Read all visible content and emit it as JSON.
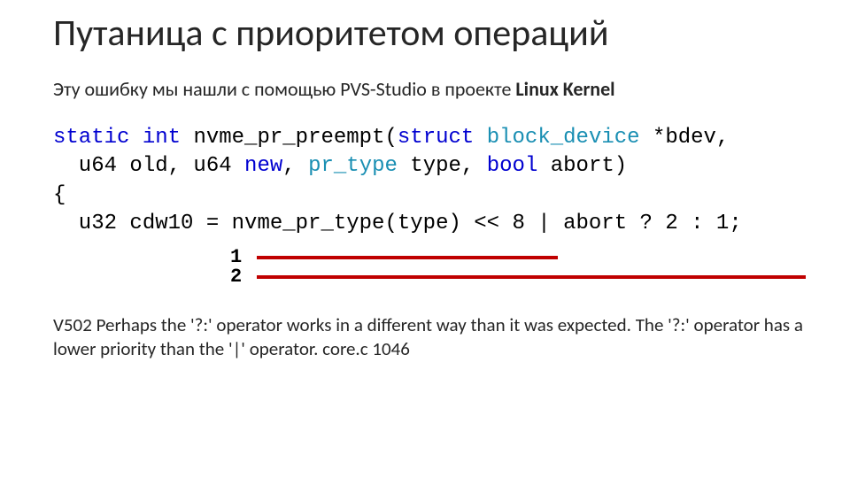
{
  "title": "Путаница с приоритетом операций",
  "subtitle_pre": "Эту ошибку мы нашли с помощью PVS-Studio в проекте ",
  "subtitle_bold": "Linux Kernel",
  "code": {
    "l1_kw1": "static",
    "l1_kw2": "int",
    "l1_fn": " nvme_pr_preempt(",
    "l1_kw3": "struct",
    "l1_sp": " ",
    "l1_type": "block_device",
    "l1_tail": " *bdev,",
    "l2_pre": "  u64 old, u64 ",
    "l2_kw_new": "new",
    "l2_mid": ", ",
    "l2_type": "pr_type",
    "l2_mid2": " type, ",
    "l2_kw_bool": "bool",
    "l2_tail": " abort)",
    "l3": "{",
    "l4": "  u32 cdw10 = nvme_pr_type(type) << 8 | abort ? 2 : 1;"
  },
  "annot": {
    "n1": "1",
    "n2": "2"
  },
  "diag": "V502 Perhaps the '?:' operator works in a different way than it was expected. The '?:' operator has a lower priority than the '|' operator. core.c 1046"
}
